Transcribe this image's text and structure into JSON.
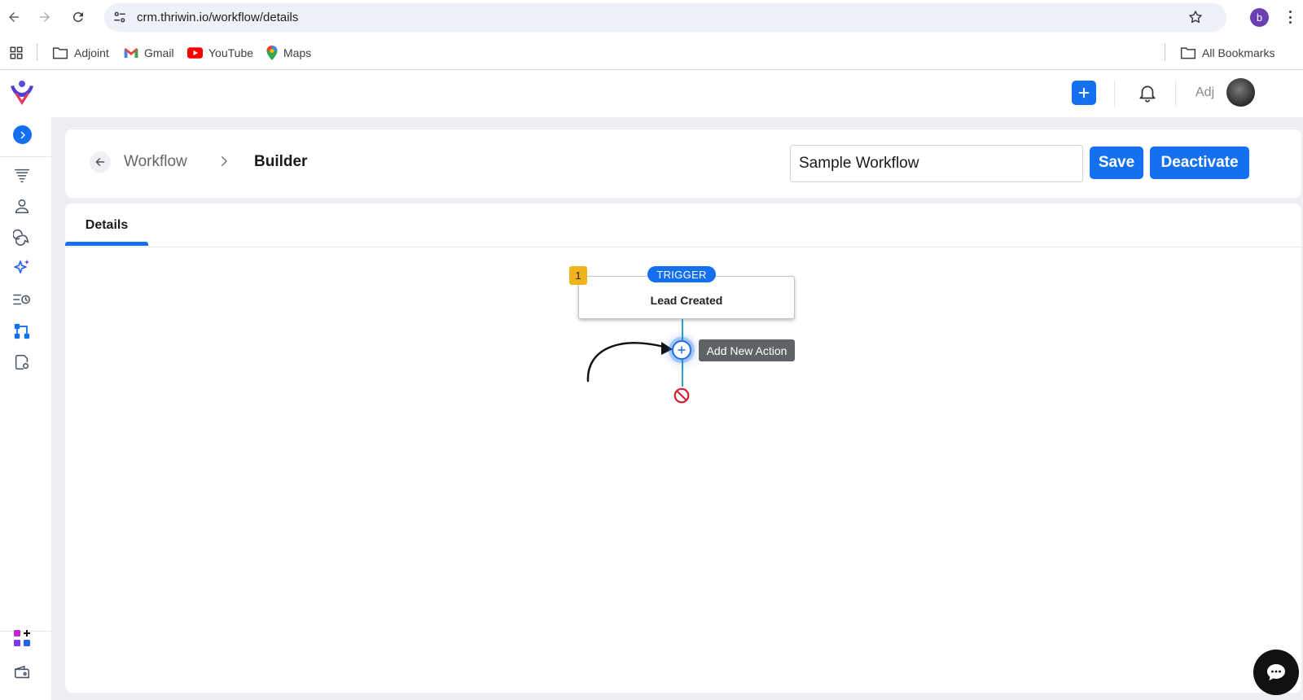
{
  "browser": {
    "url": "crm.thriwin.io/workflow/details",
    "profile_initial": "b",
    "bookmarks": [
      {
        "label": "Adjoint",
        "icon": "folder-icon"
      },
      {
        "label": "Gmail",
        "icon": "gmail-icon"
      },
      {
        "label": "YouTube",
        "icon": "youtube-icon"
      },
      {
        "label": "Maps",
        "icon": "maps-icon"
      }
    ],
    "all_bookmarks": "All Bookmarks"
  },
  "header": {
    "user_name": "Adj"
  },
  "breadcrumb": {
    "parent": "Workflow",
    "current": "Builder"
  },
  "workflow": {
    "name": "Sample Workflow",
    "save_label": "Save",
    "deactivate_label": "Deactivate"
  },
  "tabs": [
    {
      "label": "Details",
      "active": true
    }
  ],
  "flow": {
    "trigger": {
      "step_number": "1",
      "tag": "TRIGGER",
      "title": "Lead Created"
    },
    "add_action_tooltip": "Add New Action"
  },
  "colors": {
    "primary": "#1570ef",
    "badge": "#f0b31c",
    "connector": "#2a9fd6",
    "end": "#d0263a"
  }
}
